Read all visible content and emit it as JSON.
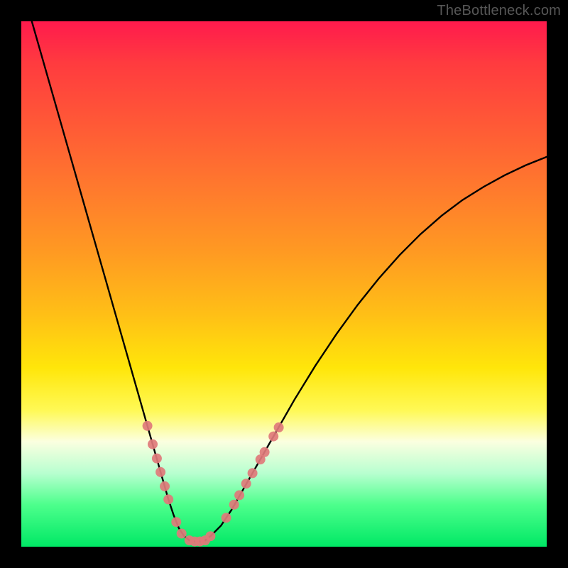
{
  "watermark": "TheBottleneck.com",
  "chart_data": {
    "type": "line",
    "title": "",
    "xlabel": "",
    "ylabel": "",
    "xlim": [
      0,
      100
    ],
    "ylim": [
      0,
      100
    ],
    "grid": false,
    "legend": false,
    "series": [
      {
        "name": "bottleneck-curve",
        "x": [
          2,
          4,
          6,
          8,
          10,
          12,
          14,
          16,
          18,
          20,
          22,
          23,
          24,
          25,
          26,
          27,
          28,
          29,
          30,
          31,
          32,
          33,
          34,
          35,
          36,
          38,
          40,
          44,
          48,
          52,
          56,
          60,
          64,
          68,
          72,
          76,
          80,
          84,
          88,
          92,
          96,
          100
        ],
        "y": [
          100,
          93,
          86,
          79,
          72,
          65,
          58,
          51,
          44,
          37,
          30,
          26.5,
          23,
          19.5,
          16,
          12.5,
          9,
          6,
          3.5,
          2,
          1.2,
          1,
          1,
          1.2,
          2,
          4,
          7,
          14,
          21,
          28,
          34.5,
          40.5,
          46,
          51,
          55.5,
          59.5,
          63,
          66,
          68.5,
          70.7,
          72.6,
          74.2
        ]
      }
    ],
    "valley_x": 33,
    "markers": {
      "name": "sample-points",
      "color": "#e07a7a",
      "radius_px": 7,
      "points": [
        {
          "x": 24.0,
          "y": 23.0
        },
        {
          "x": 25.0,
          "y": 19.5
        },
        {
          "x": 25.8,
          "y": 16.8
        },
        {
          "x": 26.5,
          "y": 14.2
        },
        {
          "x": 27.3,
          "y": 11.5
        },
        {
          "x": 28.0,
          "y": 9.0
        },
        {
          "x": 29.5,
          "y": 4.7
        },
        {
          "x": 30.5,
          "y": 2.5
        },
        {
          "x": 32.0,
          "y": 1.2
        },
        {
          "x": 33.0,
          "y": 1.0
        },
        {
          "x": 34.0,
          "y": 1.0
        },
        {
          "x": 35.0,
          "y": 1.2
        },
        {
          "x": 36.0,
          "y": 2.0
        },
        {
          "x": 39.0,
          "y": 5.5
        },
        {
          "x": 40.5,
          "y": 8.0
        },
        {
          "x": 41.5,
          "y": 9.8
        },
        {
          "x": 42.8,
          "y": 12.0
        },
        {
          "x": 44.0,
          "y": 14.0
        },
        {
          "x": 45.5,
          "y": 16.6
        },
        {
          "x": 46.3,
          "y": 18.0
        },
        {
          "x": 48.0,
          "y": 21.0
        },
        {
          "x": 49.0,
          "y": 22.7
        }
      ]
    },
    "background_gradient": {
      "top": "#ff1a4d",
      "mid_upper": "#ff9a22",
      "mid_lower": "#ffe60a",
      "bottom": "#00e865"
    }
  }
}
